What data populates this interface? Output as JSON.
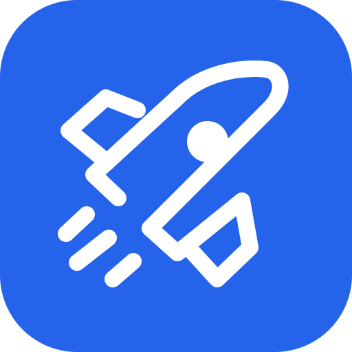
{
  "icon": {
    "name": "rocket-icon",
    "background_color": "#2563EB",
    "glyph_color": "#FFFFFF"
  }
}
